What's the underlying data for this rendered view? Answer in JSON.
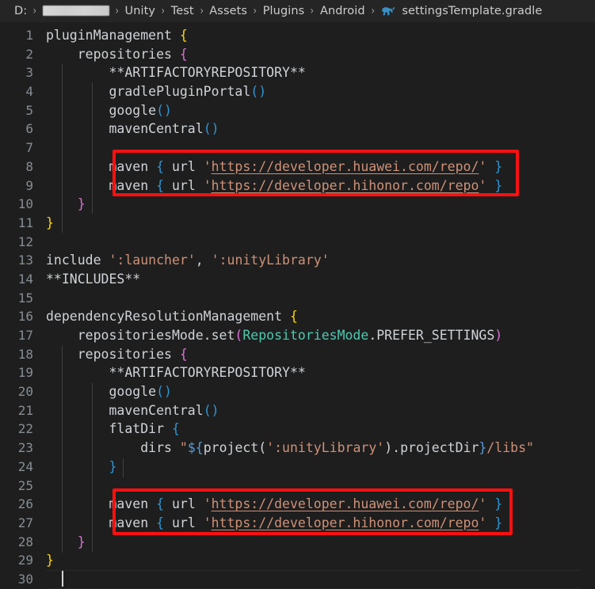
{
  "window": {
    "background": "#1e1e1e",
    "editor_background": "#1e1e1e",
    "breadcrumb_background": "#252526"
  },
  "breadcrumb": {
    "separator": "›",
    "file_icon": "gradle-elephant-icon",
    "items": [
      {
        "label": "D:",
        "redacted": false
      },
      {
        "label": "",
        "redacted": true
      },
      {
        "label": "Unity",
        "redacted": false
      },
      {
        "label": "Test",
        "redacted": false
      },
      {
        "label": "Assets",
        "redacted": false
      },
      {
        "label": "Plugins",
        "redacted": false
      },
      {
        "label": "Android",
        "redacted": false
      },
      {
        "label": "settingsTemplate.gradle",
        "redacted": false
      }
    ]
  },
  "editor": {
    "language": "gradle",
    "first_line": 1,
    "last_line": 30,
    "cursor_line": 30,
    "cursor_column": 1,
    "colors": {
      "bracket_level_1": "#ffd700",
      "bracket_level_2": "#da70d6",
      "bracket_level_3": "#2e95d3",
      "string": "#ce9178",
      "type": "#4ec9b0",
      "identifier": "#d4d4d4",
      "line_number": "#868d94",
      "indent_guide": "#404040",
      "annotation_box": "#fb1010"
    },
    "lines": [
      {
        "n": "1",
        "text": "pluginManagement {"
      },
      {
        "n": "2",
        "text": "    repositories {"
      },
      {
        "n": "3",
        "text": "        **ARTIFACTORYREPOSITORY**"
      },
      {
        "n": "4",
        "text": "        gradlePluginPortal()"
      },
      {
        "n": "5",
        "text": "        google()"
      },
      {
        "n": "6",
        "text": "        mavenCentral()"
      },
      {
        "n": "7",
        "text": ""
      },
      {
        "n": "8",
        "text": "        maven { url 'https://developer.huawei.com/repo/' }"
      },
      {
        "n": "9",
        "text": "        maven { url 'https://developer.hihonor.com/repo' }"
      },
      {
        "n": "10",
        "text": "    }"
      },
      {
        "n": "11",
        "text": "}"
      },
      {
        "n": "12",
        "text": ""
      },
      {
        "n": "13",
        "text": "include ':launcher', ':unityLibrary'"
      },
      {
        "n": "14",
        "text": "**INCLUDES**"
      },
      {
        "n": "15",
        "text": ""
      },
      {
        "n": "16",
        "text": "dependencyResolutionManagement {"
      },
      {
        "n": "17",
        "text": "    repositoriesMode.set(RepositoriesMode.PREFER_SETTINGS)"
      },
      {
        "n": "18",
        "text": "    repositories {"
      },
      {
        "n": "19",
        "text": "        **ARTIFACTORYREPOSITORY**"
      },
      {
        "n": "20",
        "text": "        google()"
      },
      {
        "n": "21",
        "text": "        mavenCentral()"
      },
      {
        "n": "22",
        "text": "        flatDir {"
      },
      {
        "n": "23",
        "text": "            dirs \"${project(':unityLibrary').projectDir}/libs\""
      },
      {
        "n": "24",
        "text": "        }"
      },
      {
        "n": "25",
        "text": ""
      },
      {
        "n": "26",
        "text": "        maven { url 'https://developer.huawei.com/repo/' }"
      },
      {
        "n": "27",
        "text": "        maven { url 'https://developer.hihonor.com/repo' }"
      },
      {
        "n": "28",
        "text": "    }"
      },
      {
        "n": "29",
        "text": "}"
      },
      {
        "n": "30",
        "text": ""
      }
    ],
    "annotations": [
      {
        "name": "highlight-box-pluginmanagement-maven",
        "lines": [
          "8",
          "9"
        ]
      },
      {
        "name": "highlight-box-dependencyresolution-maven",
        "lines": [
          "26",
          "27"
        ]
      }
    ],
    "maven_repo_urls": [
      "https://developer.huawei.com/repo/",
      "https://developer.hihonor.com/repo"
    ]
  }
}
